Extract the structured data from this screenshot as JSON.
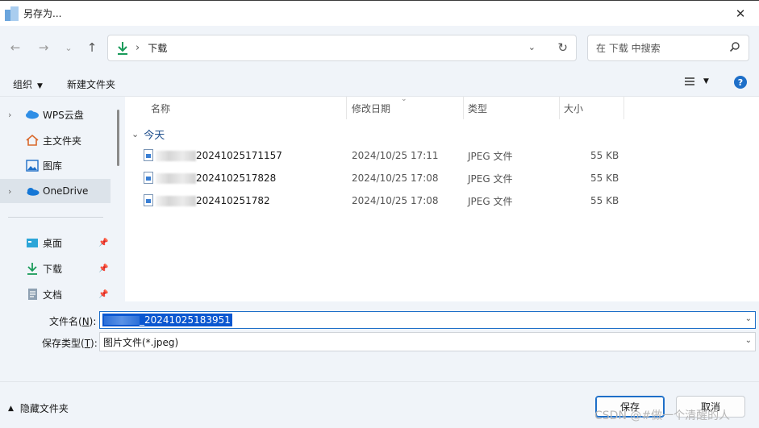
{
  "window": {
    "title": "另存为..."
  },
  "address": {
    "crumb": "下载"
  },
  "search": {
    "placeholder": "在 下载 中搜索"
  },
  "toolbar": {
    "organize": "组织",
    "new_folder": "新建文件夹"
  },
  "sidebar": {
    "items": [
      {
        "label": "WPS云盘",
        "icon": "wps-cloud-icon"
      },
      {
        "label": "主文件夹",
        "icon": "home-icon"
      },
      {
        "label": "图库",
        "icon": "gallery-icon"
      },
      {
        "label": "OneDrive",
        "icon": "onedrive-icon"
      },
      {
        "label": "桌面",
        "icon": "desktop-icon"
      },
      {
        "label": "下载",
        "icon": "download-icon"
      },
      {
        "label": "文档",
        "icon": "document-icon"
      }
    ]
  },
  "columns": {
    "name": "名称",
    "date": "修改日期",
    "type": "类型",
    "size": "大小"
  },
  "group": {
    "label": "今天"
  },
  "files": [
    {
      "name": "20241025171157",
      "date": "2024/10/25 17:11",
      "type": "JPEG 文件",
      "size": "55 KB"
    },
    {
      "name": "2024102517828",
      "date": "2024/10/25 17:08",
      "type": "JPEG 文件",
      "size": "55 KB"
    },
    {
      "name": "202410251782",
      "date": "2024/10/25 17:08",
      "type": "JPEG 文件",
      "size": "55 KB"
    }
  ],
  "form": {
    "filename_label_pre": "文件名(",
    "filename_key": "N",
    "filename_label_post": "):",
    "filename_value": "_20241025183951",
    "type_label_pre": "保存类型(",
    "type_key": "T",
    "type_label_post": "):",
    "type_value": "图片文件(*.jpeg)"
  },
  "footer": {
    "hide_folders": "隐藏文件夹",
    "save": "保存",
    "cancel": "取消",
    "watermark": "CSDN @#做一个清醒的人"
  },
  "colors": {
    "accent": "#1e6fc8",
    "selection": "#0b57d0",
    "group": "#1e4e8c"
  }
}
